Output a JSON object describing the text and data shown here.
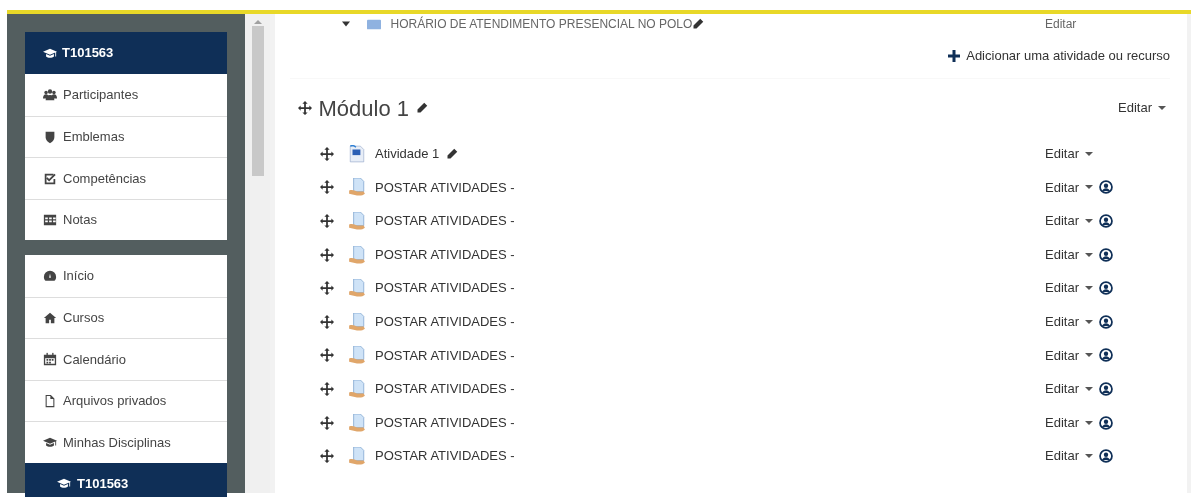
{
  "top_item": {
    "title": "HORÁRIO DE ATENDIMENTO PRESENCIAL NO POLO",
    "edit_label": "Editar"
  },
  "course_menu": {
    "title": "T101563",
    "items": [
      {
        "label": "Participantes",
        "kind": "users"
      },
      {
        "label": "Emblemas",
        "kind": "shield"
      },
      {
        "label": "Competências",
        "kind": "checkbox"
      },
      {
        "label": "Notas",
        "kind": "table"
      }
    ]
  },
  "site_menu": {
    "items": [
      {
        "label": "Início",
        "kind": "dashboard",
        "selected": false
      },
      {
        "label": "Cursos",
        "kind": "home",
        "selected": false
      },
      {
        "label": "Calendário",
        "kind": "calendar",
        "selected": false
      },
      {
        "label": "Arquivos privados",
        "kind": "file",
        "selected": false
      },
      {
        "label": "Minhas Disciplinas",
        "kind": "cap",
        "selected": false
      },
      {
        "label": "T101563",
        "kind": "cap",
        "selected": true
      }
    ]
  },
  "add_activity": "Adicionar uma atividade ou recurso",
  "section": {
    "title": "Módulo 1",
    "edit_label": "Editar",
    "activities": [
      {
        "kind": "document",
        "title": "Atividade 1",
        "edit_label": "Editar"
      },
      {
        "kind": "upload",
        "title": "POSTAR ATIVIDADES -",
        "edit_label": "Editar"
      },
      {
        "kind": "upload",
        "title": "POSTAR ATIVIDADES -",
        "edit_label": "Editar"
      },
      {
        "kind": "upload",
        "title": "POSTAR ATIVIDADES -",
        "edit_label": "Editar"
      },
      {
        "kind": "upload",
        "title": "POSTAR ATIVIDADES -",
        "edit_label": "Editar"
      },
      {
        "kind": "upload",
        "title": "POSTAR ATIVIDADES -",
        "edit_label": "Editar"
      },
      {
        "kind": "upload",
        "title": "POSTAR ATIVIDADES -",
        "edit_label": "Editar"
      },
      {
        "kind": "upload",
        "title": "POSTAR ATIVIDADES -",
        "edit_label": "Editar"
      },
      {
        "kind": "upload",
        "title": "POSTAR ATIVIDADES -",
        "edit_label": "Editar"
      },
      {
        "kind": "upload",
        "title": "POSTAR ATIVIDADES -",
        "edit_label": "Editar"
      }
    ]
  }
}
